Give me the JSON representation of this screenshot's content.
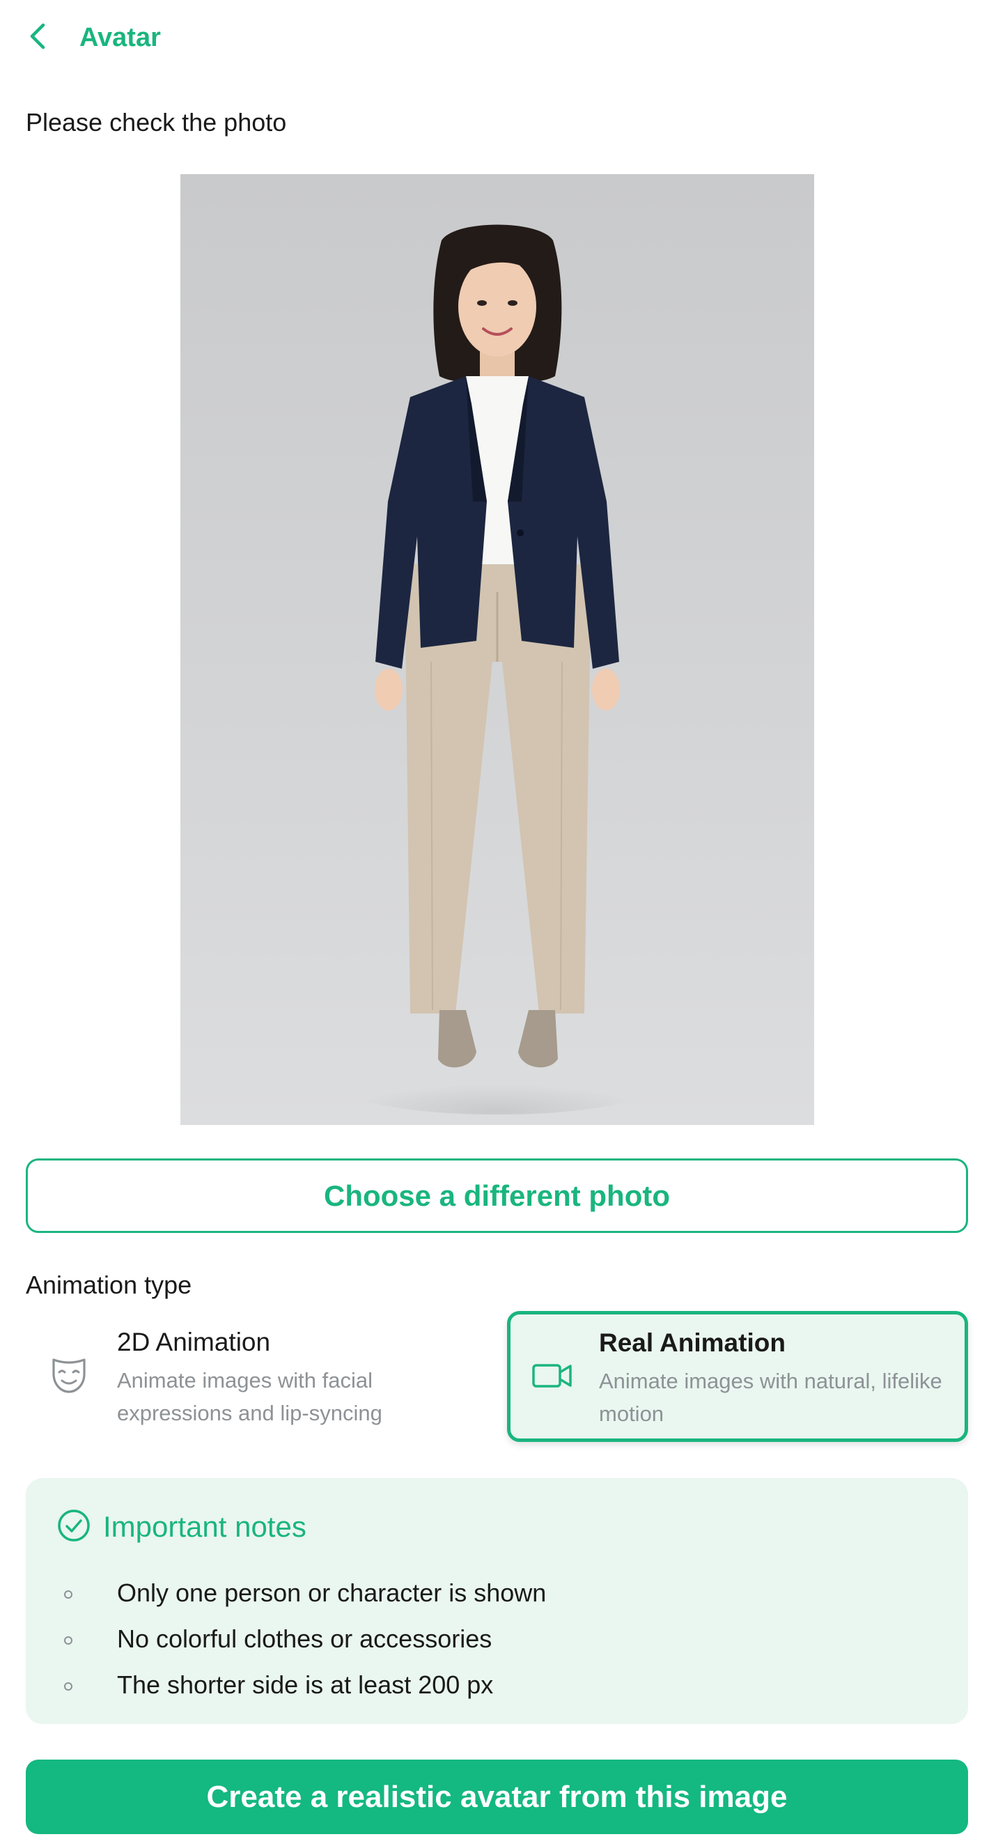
{
  "header": {
    "back_icon": "chevron-left-icon",
    "title": "Avatar"
  },
  "photo_section": {
    "label": "Please check the photo",
    "photo_alt": "Full-length photo of a woman in navy blazer and beige trousers"
  },
  "choose_button": {
    "label": "Choose a different photo"
  },
  "animation": {
    "label": "Animation type",
    "options": [
      {
        "title": "2D Animation",
        "description": "Animate images with facial expressions and lip-syncing",
        "icon": "mask-icon",
        "selected": false
      },
      {
        "title": "Real Animation",
        "description": "Animate images with natural, lifelike motion",
        "icon": "video-camera-icon",
        "selected": true
      }
    ]
  },
  "notes": {
    "icon": "check-circle-icon",
    "title": "Important notes",
    "items": [
      "Only one person or character is shown",
      "No colorful clothes or accessories",
      "The shorter side is at least 200 px"
    ]
  },
  "create_button": {
    "label": "Create a realistic avatar from this image"
  },
  "colors": {
    "accent": "#1ab57f",
    "accent_button": "#14b881",
    "selected_bg": "#eaf6f0",
    "muted_text": "#8d9296"
  }
}
